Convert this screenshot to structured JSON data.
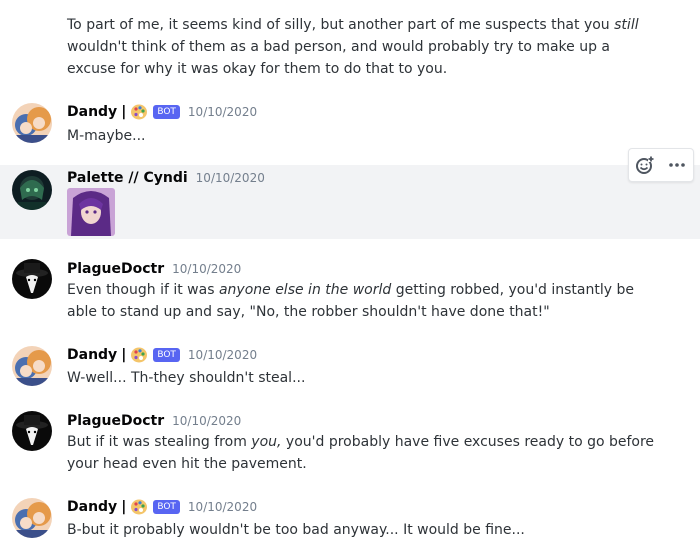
{
  "messages": [
    {
      "type": "continuation",
      "text_parts": [
        "To part of me, it seems kind of silly, but another part of me suspects that you ",
        "still",
        " wouldn't think of them as a bad person, and would probably try to make up a excuse for why it was okay for them to do that to you."
      ]
    },
    {
      "author": "Dandy",
      "separator": "|",
      "bot_badge": "BOT",
      "timestamp": "10/10/2020",
      "text": "M-maybe..."
    },
    {
      "author": "Palette // Cyndi",
      "timestamp": "10/10/2020",
      "attachment": "image-attachment"
    },
    {
      "author": "PlagueDoctr",
      "timestamp": "10/10/2020",
      "text_parts": [
        "Even though if it was ",
        "anyone else in the world",
        " getting robbed, you'd instantly be able to stand up and say, \"No, the robber shouldn't have done that!\""
      ]
    },
    {
      "author": "Dandy",
      "separator": "|",
      "bot_badge": "BOT",
      "timestamp": "10/10/2020",
      "text": "W-well... Th-they shouldn't steal..."
    },
    {
      "author": "PlagueDoctr",
      "timestamp": "10/10/2020",
      "text_parts": [
        "But if it was stealing from ",
        "you,",
        " you'd probably have five excuses ready to go before your head even hit the pavement."
      ]
    },
    {
      "author": "Dandy",
      "separator": "|",
      "bot_badge": "BOT",
      "timestamp": "10/10/2020",
      "text": "B-but it probably wouldn't be too bad anyway... It would be fine..."
    }
  ],
  "toolbar": {
    "icons": [
      "add-reaction-icon",
      "more-options-icon"
    ]
  },
  "colors": {
    "bot_badge": "#5865f2",
    "hover_background": "#f2f3f5",
    "timestamp": "#747f8d",
    "username": "#060607",
    "text": "#2e3338"
  }
}
